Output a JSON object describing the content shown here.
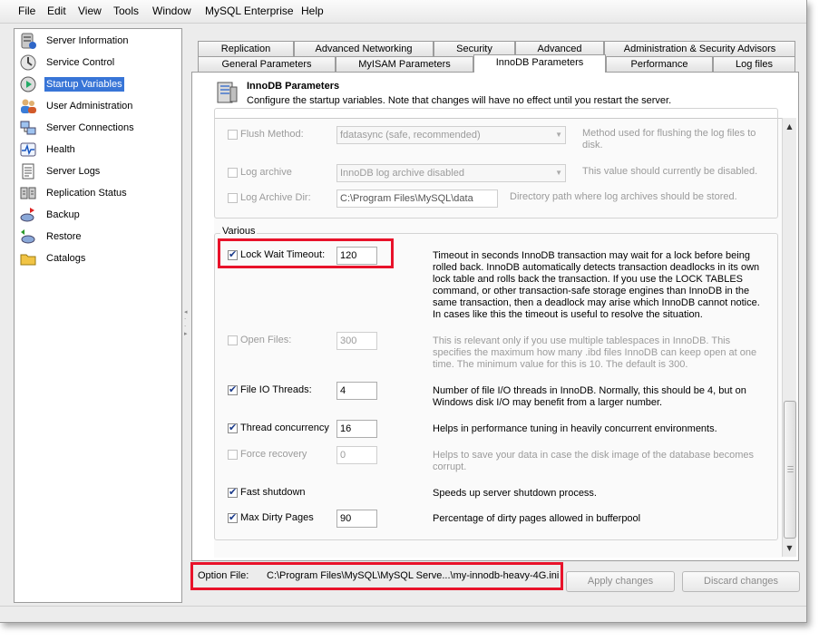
{
  "menu": [
    "File",
    "Edit",
    "View",
    "Tools",
    "Window",
    "MySQL Enterprise",
    "Help"
  ],
  "sidebar": {
    "items": [
      {
        "label": "Server Information",
        "icon": "server-info-icon",
        "selected": false
      },
      {
        "label": "Service Control",
        "icon": "service-control-icon",
        "selected": false
      },
      {
        "label": "Startup Variables",
        "icon": "startup-variables-icon",
        "selected": true
      },
      {
        "label": "User Administration",
        "icon": "users-icon",
        "selected": false
      },
      {
        "label": "Server Connections",
        "icon": "connections-icon",
        "selected": false
      },
      {
        "label": "Health",
        "icon": "health-icon",
        "selected": false
      },
      {
        "label": "Server Logs",
        "icon": "logs-icon",
        "selected": false
      },
      {
        "label": "Replication Status",
        "icon": "replication-icon",
        "selected": false
      },
      {
        "label": "Backup",
        "icon": "backup-icon",
        "selected": false
      },
      {
        "label": "Restore",
        "icon": "restore-icon",
        "selected": false
      },
      {
        "label": "Catalogs",
        "icon": "catalogs-icon",
        "selected": false
      }
    ]
  },
  "tabs": {
    "row1": [
      "Replication",
      "Advanced Networking",
      "Security",
      "Advanced",
      "Administration & Security Advisors"
    ],
    "row2": [
      "General Parameters",
      "MyISAM Parameters",
      "InnoDB Parameters",
      "Performance",
      "Log files"
    ],
    "active": "InnoDB Parameters"
  },
  "header": {
    "title": "InnoDB Parameters",
    "subtitle": "Configure the startup variables. Note that changes will have no effect until you restart the server."
  },
  "logs_group": {
    "rows": [
      {
        "label": "Flush Method:",
        "checked": false,
        "enabled": false,
        "value": "fdatasync (safe, recommended)",
        "control": "select",
        "desc": "Method used for flushing the log files to disk."
      },
      {
        "label": "Log archive",
        "checked": false,
        "enabled": false,
        "value": "InnoDB log archive disabled",
        "control": "select",
        "desc": "This value should currently be disabled."
      },
      {
        "label": "Log Archive Dir:",
        "checked": false,
        "enabled": false,
        "value": "C:\\Program Files\\MySQL\\data",
        "control": "input",
        "desc": "Directory path where log archives should be stored."
      }
    ]
  },
  "various": {
    "title": "Various",
    "rows": [
      {
        "label": "Lock Wait Timeout:",
        "checked": true,
        "enabled": true,
        "value": "120",
        "desc": "Timeout in seconds InnoDB transaction may wait for a lock before being rolled back. InnoDB automatically detects transaction deadlocks in its own lock table and rolls back the transaction. If you use the LOCK TABLES command, or other transaction-safe storage engines than InnoDB in the same transaction, then a deadlock may arise which InnoDB cannot notice. In cases like this the timeout is useful to resolve the situation."
      },
      {
        "label": "Open Files:",
        "checked": false,
        "enabled": false,
        "value": "300",
        "desc": "This is relevant only if you use multiple tablespaces in InnoDB. This specifies the maximum how many .ibd files InnoDB can keep open at one time. The minimum value for this is 10. The default is 300."
      },
      {
        "label": "File IO Threads:",
        "checked": true,
        "enabled": true,
        "value": "4",
        "desc": "Number of file I/O threads in InnoDB. Normally, this should be 4, but on Windows disk I/O may benefit from a larger number."
      },
      {
        "label": "Thread concurrency",
        "checked": true,
        "enabled": true,
        "value": "16",
        "desc": "Helps in performance tuning in heavily concurrent environments."
      },
      {
        "label": "Force recovery",
        "checked": false,
        "enabled": false,
        "value": "0",
        "desc": "Helps to save your data in case the disk image of the database becomes corrupt."
      },
      {
        "label": "Fast shutdown",
        "checked": true,
        "enabled": true,
        "value": null,
        "desc": "Speeds up server shutdown process."
      },
      {
        "label": "Max Dirty Pages",
        "checked": true,
        "enabled": true,
        "value": "90",
        "desc": "Percentage of dirty pages allowed in bufferpool"
      }
    ]
  },
  "footer": {
    "option_file_label": "Option File:",
    "option_file_path": "C:\\Program Files\\MySQL\\MySQL Serve...\\my-innodb-heavy-4G.ini",
    "apply_label": "Apply changes",
    "discard_label": "Discard changes"
  },
  "colors": {
    "selection": "#3875d7",
    "highlight": "#e8122a"
  }
}
